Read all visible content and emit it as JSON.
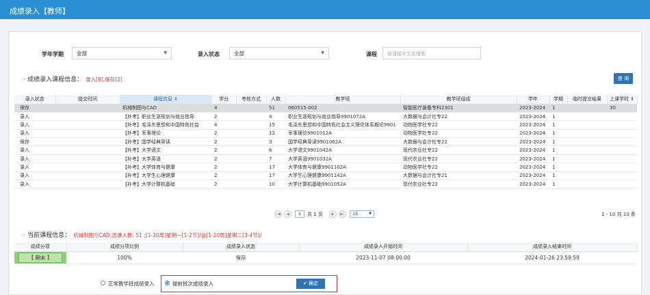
{
  "window_title": "成绩录入【教师】",
  "filters": {
    "term_label": "学年学期",
    "term_value": "全部",
    "status_label": "录入状态",
    "status_value": "全部",
    "course_label": "课程",
    "course_placeholder": "按课程中文名搜索"
  },
  "course_info": {
    "title": "成绩录入课程信息：",
    "counts": "录入[8],保存[2]",
    "query_label": "查 询"
  },
  "table": {
    "columns": [
      "录入状态",
      "提交时间",
      "课程信息 ⇕",
      "学分",
      "考核方式",
      "人数",
      "教学班",
      "教学班组成",
      "学年",
      "学期",
      "临时提交结果",
      "上课学时 ⇕"
    ],
    "rows": [
      [
        "保存",
        "",
        "机械制图与CAD",
        "4",
        "",
        "51",
        "060515-002",
        "智能医疗装备专科2301",
        "2023-2024",
        "1",
        "",
        "30"
      ],
      [
        "录入",
        "",
        "【补考】职业生涯规划与就业指导",
        "2",
        "",
        "4",
        "职业生涯规划与就业指导9901072A",
        "大数据与会计社专22",
        "2023-2024",
        "1",
        "",
        ""
      ],
      [
        "录入",
        "",
        "【补考】毛泽东思想和中国特色社会",
        "4",
        "",
        "15",
        "毛泽东思想和中国特色社会主义理论体系概论9901",
        "动物医学社专22",
        "2023-2024",
        "1",
        "",
        ""
      ],
      [
        "录入",
        "",
        "【补考】军事理论",
        "2",
        "",
        "12",
        "军事理论9901012A",
        "动物医学社专22",
        "2023-2024",
        "1",
        "",
        ""
      ],
      [
        "保存",
        "",
        "【补考】国学经典导读",
        "2",
        "",
        "3",
        "国学经典导读9901062A",
        "大数据与会计社专22",
        "2023-2024",
        "1",
        "",
        ""
      ],
      [
        "录入",
        "",
        "【补考】大学语文",
        "2",
        "",
        "6",
        "大学语文9901042A",
        "现代农业社专22",
        "2023-2024",
        "1",
        "",
        ""
      ],
      [
        "录入",
        "",
        "【补考】大学英语",
        "2",
        "",
        "7",
        "大学英语9901032A",
        "现代农业社专22",
        "2023-2024",
        "1",
        "",
        ""
      ],
      [
        "录入",
        "",
        "【补考】大学体育与健康",
        "2",
        "",
        "17",
        "大学体育与健康9901102A",
        "动物医学社专22",
        "2023-2024",
        "1",
        "",
        ""
      ],
      [
        "录入",
        "",
        "【补考】大学生心理健康",
        "2",
        "",
        "17",
        "大学生心理健康9901142A",
        "大数据与会计社专21",
        "2023-2024",
        "1",
        "",
        ""
      ],
      [
        "录入",
        "",
        "【补考】大学计算机基础",
        "2",
        "",
        "10",
        "大学计算机基础9901052A",
        "现代农业社专22",
        "2023-2024",
        "1",
        "",
        ""
      ]
    ]
  },
  "pager": {
    "page": "1",
    "total_text": "共 1 页",
    "page_size": "15",
    "range_text": "1 - 10  共 10 条"
  },
  "current_info": {
    "title": "当前课程信息：",
    "detail": "机械制图与CAD;选课人数: 51 ;[1-20周]星期一[1-2节]/@[1-20周]星期二[3-4节]/",
    "columns": [
      "成绩分项",
      "成绩分项比例",
      "成绩录入状态",
      "成绩录入开始时间",
      "成绩录入结束时间"
    ],
    "row": [
      "【 期末 】",
      "100%",
      "保存",
      "2023-11-07 08:00:00",
      "2024-01-26 23:59:59"
    ]
  },
  "options": {
    "normal_label": "正常教学班成绩录入",
    "advance_label": "提前批次成绩录入",
    "confirm_label": "✔ 确定"
  },
  "colors": {
    "header_blue": "#2a8fd3",
    "button_blue": "#2f73b8",
    "highlight_red": "#d92c27",
    "status_text_red": "#d9352c",
    "term_green": "#8fd07a"
  }
}
